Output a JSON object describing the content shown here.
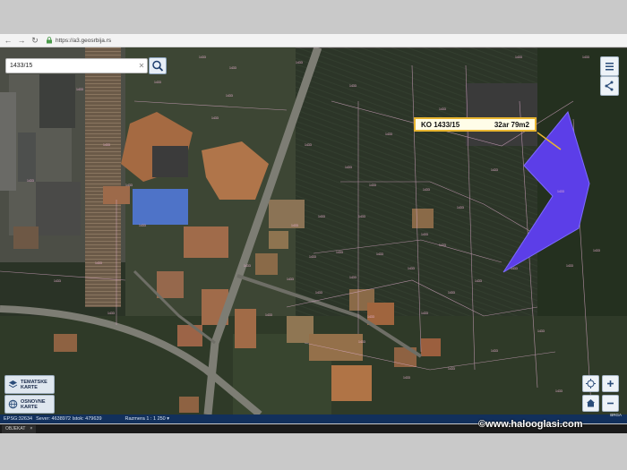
{
  "browser": {
    "url": "https://a3.geosrbija.rs",
    "icons": [
      "back-icon",
      "forward-icon",
      "reload-icon",
      "lock-icon"
    ]
  },
  "search": {
    "value": "1433/15",
    "placeholder": ""
  },
  "parcel_label": {
    "id": "KO 1433/15",
    "area": "32ar 79m2"
  },
  "layer_buttons": [
    {
      "label": "TEMATSKE\nKARTE"
    },
    {
      "label": "OSNOVNE\nKARTE"
    }
  ],
  "status": {
    "epsg": "EPSG:32634",
    "coords": "Sever: 4638972 Istok: 479639",
    "scale": "Razmera 1 : 1 250 ▾"
  },
  "bottom_tab": {
    "label": "OBJEKAT",
    "close": "×"
  },
  "watermark": "©www.halooglasi.com",
  "attribution": "BRGA",
  "colors": {
    "parcel_fill": "#5c3ee8",
    "label_border": "#e8b530",
    "status_bg": "#12305c"
  }
}
